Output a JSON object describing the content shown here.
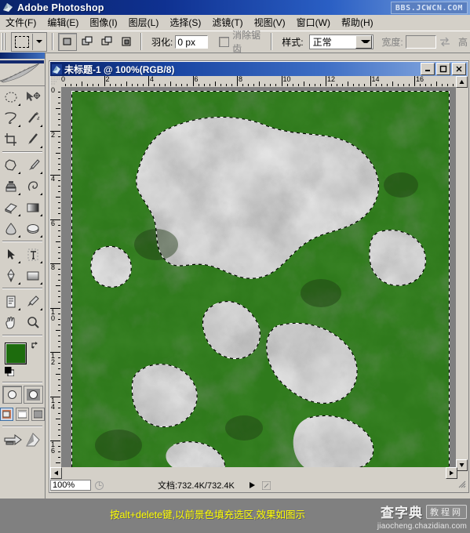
{
  "app": {
    "title": "Adobe Photoshop",
    "icon": "photoshop-icon",
    "titlebar_watermark": "BBS.JCWCN.COM"
  },
  "menubar": {
    "items": [
      {
        "label": "文件(F)",
        "name": "menu-file"
      },
      {
        "label": "编辑(E)",
        "name": "menu-edit"
      },
      {
        "label": "图像(I)",
        "name": "menu-image"
      },
      {
        "label": "图层(L)",
        "name": "menu-layer"
      },
      {
        "label": "选择(S)",
        "name": "menu-select"
      },
      {
        "label": "滤镜(T)",
        "name": "menu-filter"
      },
      {
        "label": "视图(V)",
        "name": "menu-view"
      },
      {
        "label": "窗口(W)",
        "name": "menu-window"
      },
      {
        "label": "帮助(H)",
        "name": "menu-help"
      }
    ]
  },
  "options_bar": {
    "tool_preset_icon": "rectangular-marquee-icon",
    "selection_modes": [
      "new-selection",
      "add-to-selection",
      "subtract-from-selection",
      "intersect-selection"
    ],
    "selection_mode_active": 0,
    "feather_label": "羽化:",
    "feather_value": "0 px",
    "antialias_label": "消除锯齿",
    "antialias_checked": false,
    "style_label": "样式:",
    "style_value": "正常",
    "width_label": "宽度:",
    "width_value": "",
    "swap_icon": "swap-arrows-icon",
    "height_label": "高"
  },
  "toolbox": {
    "tools": [
      {
        "name": "elliptical-marquee-tool",
        "glyph": "ellipse-marquee"
      },
      {
        "name": "move-tool",
        "glyph": "move"
      },
      {
        "name": "lasso-tool",
        "glyph": "lasso"
      },
      {
        "name": "magic-wand-tool",
        "glyph": "wand"
      },
      {
        "name": "crop-tool",
        "glyph": "crop"
      },
      {
        "name": "slice-tool",
        "glyph": "slice"
      },
      {
        "name": "healing-brush-tool",
        "glyph": "patch"
      },
      {
        "name": "brush-tool",
        "glyph": "brush"
      },
      {
        "name": "clone-stamp-tool",
        "glyph": "stamp"
      },
      {
        "name": "history-brush-tool",
        "glyph": "historybrush"
      },
      {
        "name": "eraser-tool",
        "glyph": "eraser"
      },
      {
        "name": "gradient-tool",
        "glyph": "gradient"
      },
      {
        "name": "blur-tool",
        "glyph": "blur"
      },
      {
        "name": "dodge-tool",
        "glyph": "dodge"
      },
      {
        "name": "path-selection-tool",
        "glyph": "pathselect"
      },
      {
        "name": "type-tool",
        "glyph": "type"
      },
      {
        "name": "pen-tool",
        "glyph": "pen"
      },
      {
        "name": "shape-tool",
        "glyph": "shape"
      },
      {
        "name": "notes-tool",
        "glyph": "notes"
      },
      {
        "name": "eyedropper-tool",
        "glyph": "eyedropper"
      },
      {
        "name": "hand-tool",
        "glyph": "hand"
      },
      {
        "name": "zoom-tool",
        "glyph": "zoom"
      }
    ],
    "foreground_color": "#1d6c0d",
    "background_color": "#ffffff",
    "quickmask_modes": [
      "standard-mode",
      "quick-mask-mode"
    ],
    "screen_modes": [
      "standard-screen-mode",
      "full-screen-with-menubar",
      "full-screen-mode"
    ],
    "screen_mode_active": 0,
    "jump_to_imageready": "jump-to-imageready"
  },
  "document": {
    "title": "未标题-1 @ 100%(RGB/8)",
    "window_buttons": [
      "minimize",
      "maximize",
      "close"
    ],
    "ruler_h_ticks": [
      "0",
      "2",
      "4",
      "6",
      "8",
      "10",
      "12",
      "14",
      "16"
    ],
    "ruler_v_ticks": [
      "0",
      "2",
      "4",
      "6",
      "8",
      "10",
      "12",
      "14",
      "16"
    ],
    "status_zoom": "100%",
    "status_doc": "文档:732.4K/732.4K",
    "canvas_green": "#2f7a1c",
    "canvas_cloud": "#c8c8c8"
  },
  "caption": {
    "text": "按alt+delete键,以前景色填充选区,效果如图示",
    "color": "#ffff00"
  },
  "watermark": {
    "brand": "查字典",
    "tag": "教程网",
    "url": "jiaocheng.chazidian.com"
  }
}
